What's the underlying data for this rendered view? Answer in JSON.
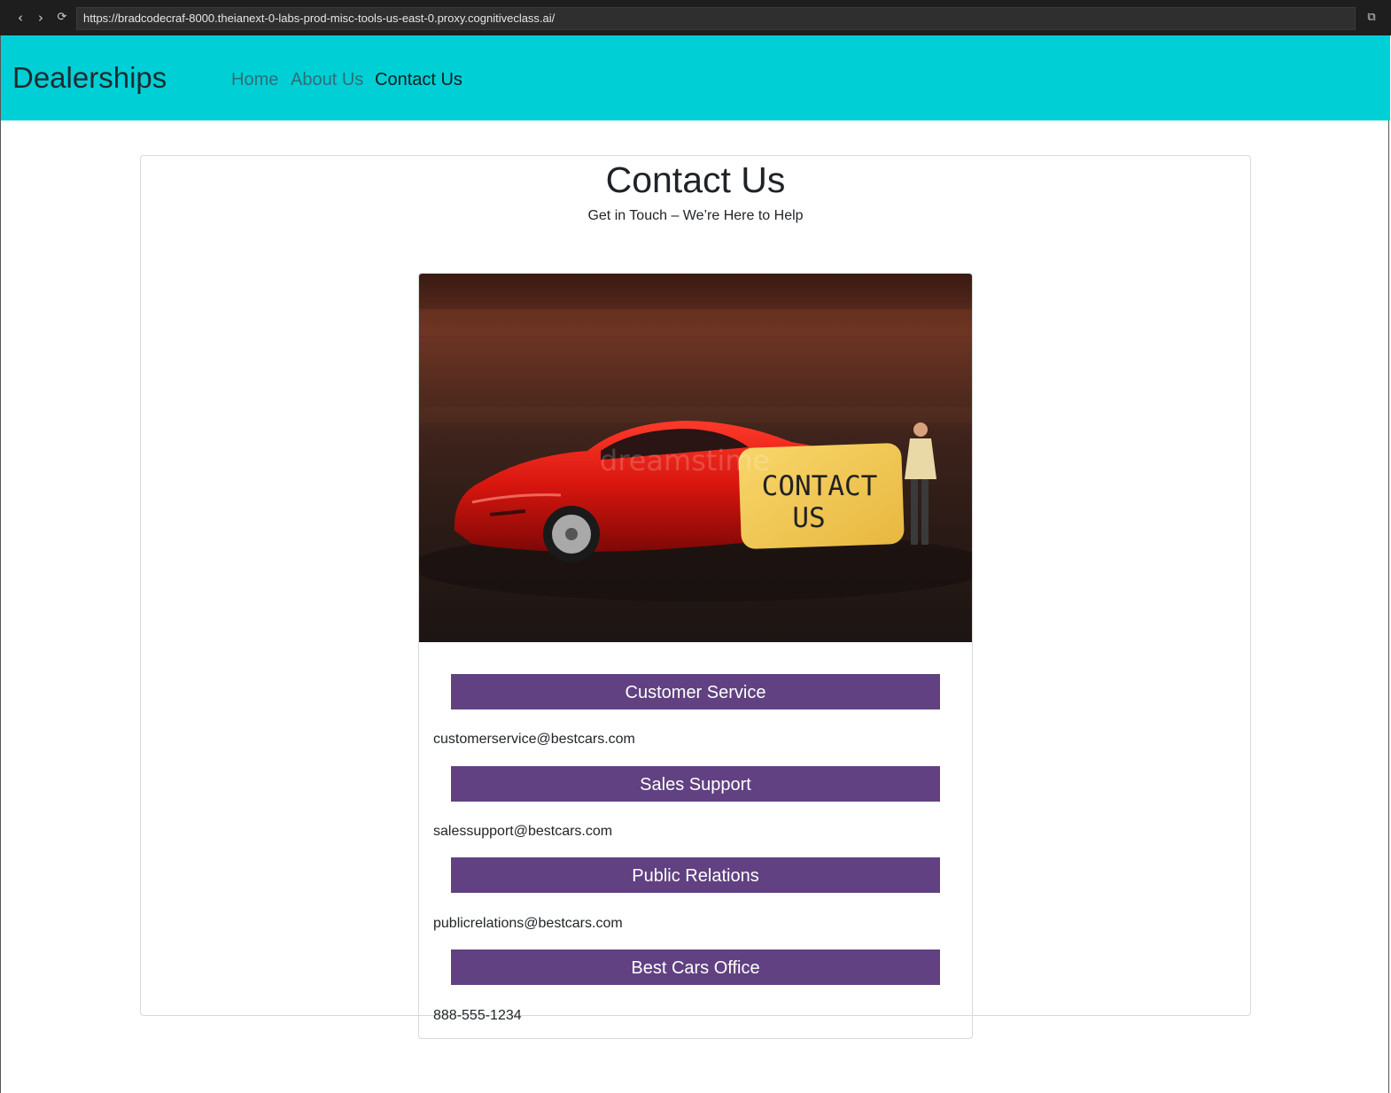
{
  "browser": {
    "back_glyph": "‹",
    "forward_glyph": "›",
    "reload_glyph": "⟳",
    "url": "https://bradcodecraf-8000.theianext-0-labs-prod-misc-tools-us-east-0.proxy.cognitiveclass.ai/",
    "external_glyph": "⧉"
  },
  "navbar": {
    "brand": "Dealerships",
    "links": [
      "Home",
      "About Us",
      "Contact Us"
    ],
    "active": "Contact Us",
    "background": "#00cfd5"
  },
  "main": {
    "title": "Contact Us",
    "subtitle": "Get in Touch – We’re Here to Help",
    "hero_image": {
      "sign_line1": "CONTACT",
      "sign_line2": "US",
      "watermark": "dreamstime"
    },
    "sections": [
      {
        "heading": "Customer Service",
        "value": "customerservice@bestcars.com"
      },
      {
        "heading": "Sales Support",
        "value": "salessupport@bestcars.com"
      },
      {
        "heading": "Public Relations",
        "value": "publicrelations@bestcars.com"
      },
      {
        "heading": "Best Cars Office",
        "value": "888-555-1234"
      }
    ],
    "header_color": "#614181"
  }
}
